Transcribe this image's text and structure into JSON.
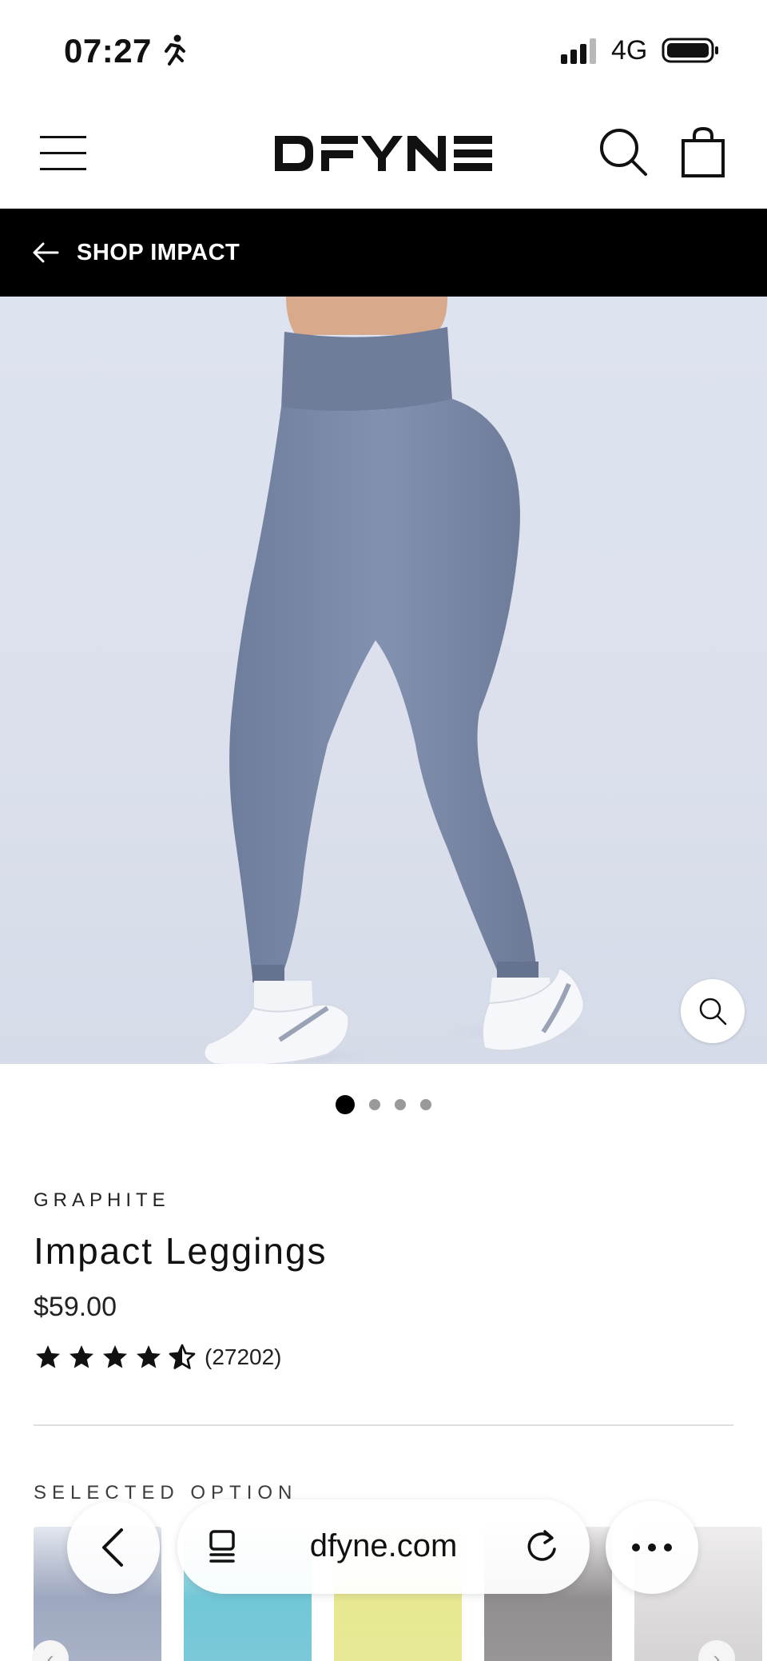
{
  "status_bar": {
    "time": "07:27",
    "network": "4G"
  },
  "header": {
    "brand": "DFYNE"
  },
  "back_bar": {
    "label": "SHOP IMPACT"
  },
  "product": {
    "variant": "GRAPHITE",
    "title": "Impact Leggings",
    "price": "$59.00",
    "rating_value": 4.5,
    "review_count": "(27202)",
    "image_count": 4,
    "active_image": 1
  },
  "options": {
    "label": "SELECTED OPTION"
  },
  "browser": {
    "url": "dfyne.com"
  },
  "colors": {
    "legging": "#7a88a8",
    "background": "#dde3ef",
    "bar": "#000000"
  }
}
